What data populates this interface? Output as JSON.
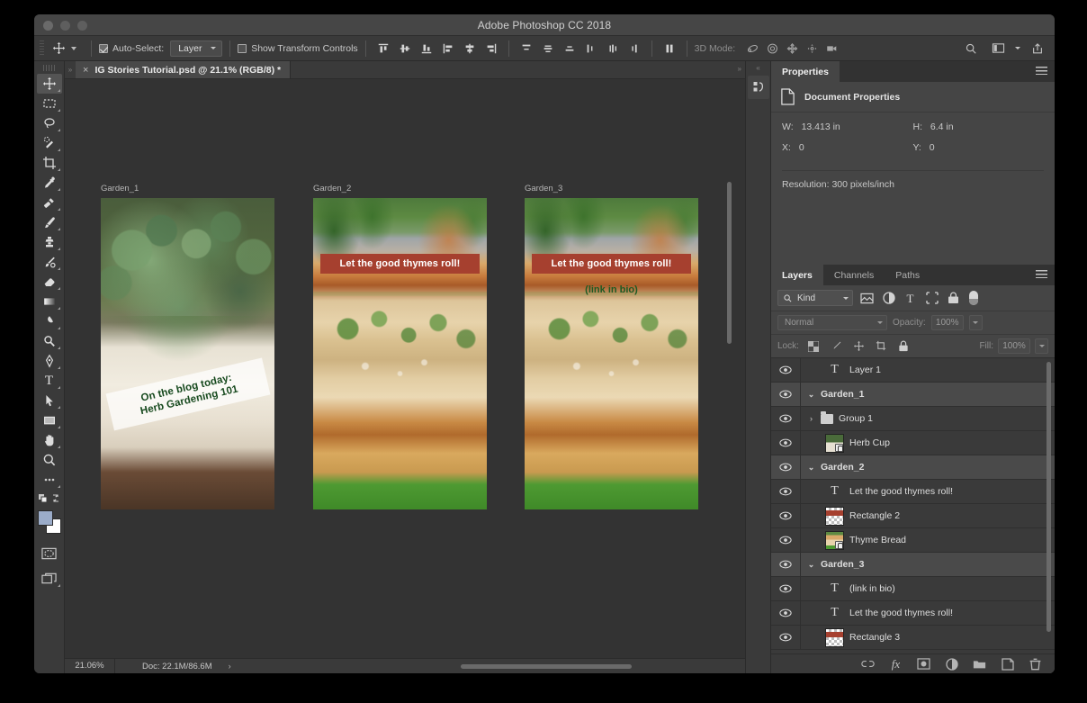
{
  "window": {
    "title": "Adobe Photoshop CC 2018",
    "traffic_lights": [
      "close",
      "minimize",
      "zoom"
    ]
  },
  "options_bar": {
    "active_tool": "move-tool",
    "auto_select_checked": true,
    "auto_select_label": "Auto-Select:",
    "auto_select_value": "Layer",
    "show_transform_label": "Show Transform Controls",
    "show_transform_checked": false,
    "mode_3d_label": "3D Mode:",
    "align_icons": [
      "align-top-edges",
      "align-vertical-centers",
      "align-bottom-edges",
      "align-left-edges",
      "align-horizontal-centers",
      "align-right-edges"
    ],
    "distribute_icons": [
      "distribute-top-edges",
      "distribute-vertical-centers",
      "distribute-bottom-edges",
      "distribute-left-edges",
      "distribute-horizontal-centers",
      "distribute-right-edges"
    ],
    "extra_icons": [
      "distribute-spacing"
    ],
    "mode_3d_icons": [
      "orbit-3d",
      "roll-3d",
      "pan-3d",
      "slide-3d",
      "camera-3d"
    ],
    "right_icons": [
      "search-icon",
      "workspace-icon",
      "chevron-down-icon",
      "share-icon"
    ]
  },
  "toolbox": {
    "tools": [
      {
        "name": "move-tool",
        "selected": true
      },
      {
        "name": "rectangular-marquee-tool",
        "selected": false
      },
      {
        "name": "lasso-tool",
        "selected": false
      },
      {
        "name": "quick-selection-tool",
        "selected": false
      },
      {
        "name": "crop-tool",
        "selected": false
      },
      {
        "name": "eyedropper-tool",
        "selected": false
      },
      {
        "name": "spot-healing-brush-tool",
        "selected": false
      },
      {
        "name": "brush-tool",
        "selected": false
      },
      {
        "name": "clone-stamp-tool",
        "selected": false
      },
      {
        "name": "history-brush-tool",
        "selected": false
      },
      {
        "name": "eraser-tool",
        "selected": false
      },
      {
        "name": "gradient-tool",
        "selected": false
      },
      {
        "name": "blur-tool",
        "selected": false
      },
      {
        "name": "dodge-tool",
        "selected": false
      },
      {
        "name": "pen-tool",
        "selected": false
      },
      {
        "name": "type-tool",
        "selected": false
      },
      {
        "name": "path-selection-tool",
        "selected": false
      },
      {
        "name": "rectangle-tool",
        "selected": false
      },
      {
        "name": "hand-tool",
        "selected": false
      },
      {
        "name": "zoom-tool",
        "selected": false
      },
      {
        "name": "edit-toolbar-tool",
        "selected": false
      }
    ],
    "foreground_color": "#9bacc9",
    "background_color": "#ffffff",
    "bottom_icons": [
      "quick-mask-icon",
      "screen-mode-icon"
    ]
  },
  "document_tab": {
    "close_glyph": "×",
    "title": "IG Stories Tutorial.psd @ 21.1% (RGB/8) *"
  },
  "canvas": {
    "background_color": "#333333",
    "artboards": [
      {
        "label": "Garden_1",
        "image": "herb-cup-photo",
        "overlay_text": "On the blog today:\nHerb Gardening 101",
        "overlay_line_1": "On the blog today:",
        "overlay_line_2": "Herb Gardening 101",
        "overlay_text_color": "#16491d"
      },
      {
        "label": "Garden_2",
        "image": "thyme-bread-photo",
        "banner_text": "Let the good thymes roll!",
        "banner_color": "#a6402f"
      },
      {
        "label": "Garden_3",
        "image": "thyme-bread-photo",
        "banner_text": "Let the good thymes roll!",
        "banner_color": "#a6402f",
        "bio_text": "(link in bio)",
        "bio_text_color": "#1d5a23"
      }
    ]
  },
  "status_bar": {
    "zoom": "21.06%",
    "doc_info": "Doc: 22.1M/86.6M",
    "arrow_glyph": "›"
  },
  "mini_dock": {
    "icons": [
      "libraries-icon"
    ]
  },
  "properties_panel": {
    "tab_label": "Properties",
    "menu_icon": "panel-menu-icon",
    "header_icon": "document-properties-icon",
    "header_label": "Document Properties",
    "fields": [
      {
        "key": "W:",
        "value": "13.413 in"
      },
      {
        "key": "H:",
        "value": "6.4 in"
      },
      {
        "key": "X:",
        "value": "0"
      },
      {
        "key": "Y:",
        "value": "0"
      }
    ],
    "resolution_label": "Resolution: 300 pixels/inch"
  },
  "layers_panel": {
    "tabs": [
      {
        "label": "Layers",
        "active": true
      },
      {
        "label": "Channels",
        "active": false
      },
      {
        "label": "Paths",
        "active": false
      }
    ],
    "menu_icon": "panel-menu-icon",
    "filter": {
      "search_icon": "search-icon",
      "kind_label": "Kind",
      "type_icons": [
        "pixel-filter-icon",
        "adjustment-filter-icon",
        "type-filter-icon",
        "shape-filter-icon",
        "smart-object-filter-icon"
      ],
      "toggle_icon": "filter-toggle-switch"
    },
    "blend": {
      "mode": "Normal",
      "opacity_label": "Opacity:",
      "opacity_value": "100%"
    },
    "lock": {
      "label": "Lock:",
      "icons": [
        "lock-transparent-pixels-icon",
        "lock-image-pixels-icon",
        "lock-position-icon",
        "lock-artboard-nesting-icon",
        "lock-all-icon"
      ],
      "fill_label": "Fill:",
      "fill_value": "100%"
    },
    "layers": [
      {
        "name": "Layer 1",
        "type": "text",
        "kind": "layer",
        "visible": true,
        "indent": 1
      },
      {
        "name": "Garden_1",
        "type": "artboard",
        "kind": "group",
        "visible": true,
        "indent": 0,
        "expanded": true
      },
      {
        "name": "Group 1",
        "type": "folder",
        "kind": "layer",
        "visible": true,
        "indent": 1,
        "expanded": false
      },
      {
        "name": "Herb Cup",
        "type": "image-herb",
        "kind": "layer",
        "visible": true,
        "indent": 1
      },
      {
        "name": "Garden_2",
        "type": "artboard",
        "kind": "group",
        "visible": true,
        "indent": 0,
        "expanded": true
      },
      {
        "name": "Let the good thymes roll!",
        "type": "text",
        "kind": "layer",
        "visible": true,
        "indent": 1
      },
      {
        "name": "Rectangle 2",
        "type": "image-shape",
        "kind": "layer",
        "visible": true,
        "indent": 1
      },
      {
        "name": "Thyme Bread",
        "type": "image-bread",
        "kind": "layer",
        "visible": true,
        "indent": 1
      },
      {
        "name": "Garden_3",
        "type": "artboard",
        "kind": "group",
        "visible": true,
        "indent": 0,
        "expanded": true
      },
      {
        "name": "(link in bio)",
        "type": "text",
        "kind": "layer",
        "visible": true,
        "indent": 1
      },
      {
        "name": "Let the good thymes roll!",
        "type": "text",
        "kind": "layer",
        "visible": true,
        "indent": 1
      },
      {
        "name": "Rectangle 3",
        "type": "image-shape",
        "kind": "layer",
        "visible": true,
        "indent": 1
      }
    ],
    "footer_icons": [
      "link-layers-icon",
      "layer-style-fx-icon",
      "add-layer-mask-icon",
      "new-adjustment-layer-icon",
      "new-group-icon",
      "new-layer-icon",
      "delete-layer-icon"
    ],
    "footer_fx_label": "fx"
  }
}
